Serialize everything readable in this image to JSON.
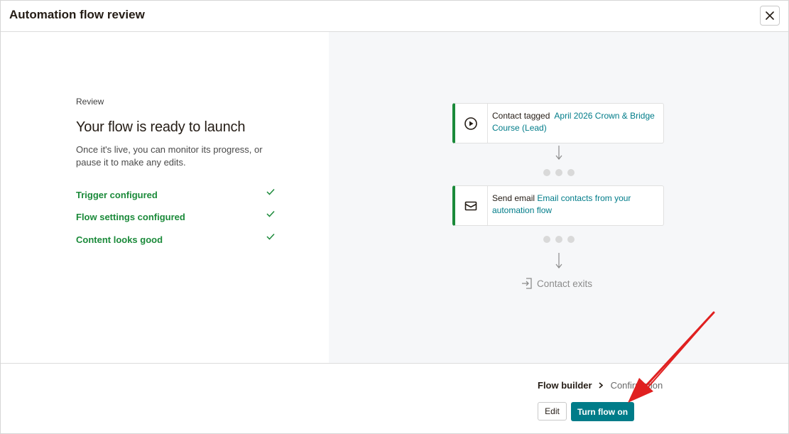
{
  "modal": {
    "title": "Automation flow review",
    "close_icon": "close-icon"
  },
  "review": {
    "label": "Review",
    "headline": "Your flow is ready to launch",
    "description": "Once it's live, you can monitor its progress, or pause it to make any edits.",
    "checks": [
      {
        "label": "Trigger configured",
        "icon": "checkmark-icon"
      },
      {
        "label": "Flow settings configured",
        "icon": "checkmark-icon"
      },
      {
        "label": "Content looks good",
        "icon": "checkmark-icon"
      }
    ]
  },
  "flow": {
    "trigger": {
      "icon": "play-circle-icon",
      "action": "Contact tagged",
      "detail": "April 2026 Crown & Bridge Course (Lead)"
    },
    "email": {
      "icon": "envelope-icon",
      "action": "Send email",
      "detail": "Email contacts from your automation flow"
    },
    "exit": {
      "icon": "exit-icon",
      "label": "Contact exits"
    }
  },
  "footer": {
    "breadcrumb": {
      "active": "Flow builder",
      "next": "Confirmation"
    },
    "edit_label": "Edit",
    "turn_on_label": "Turn flow on"
  },
  "colors": {
    "accent": "#007c89",
    "success": "#1b8a3a",
    "annotation": "#e02020"
  }
}
